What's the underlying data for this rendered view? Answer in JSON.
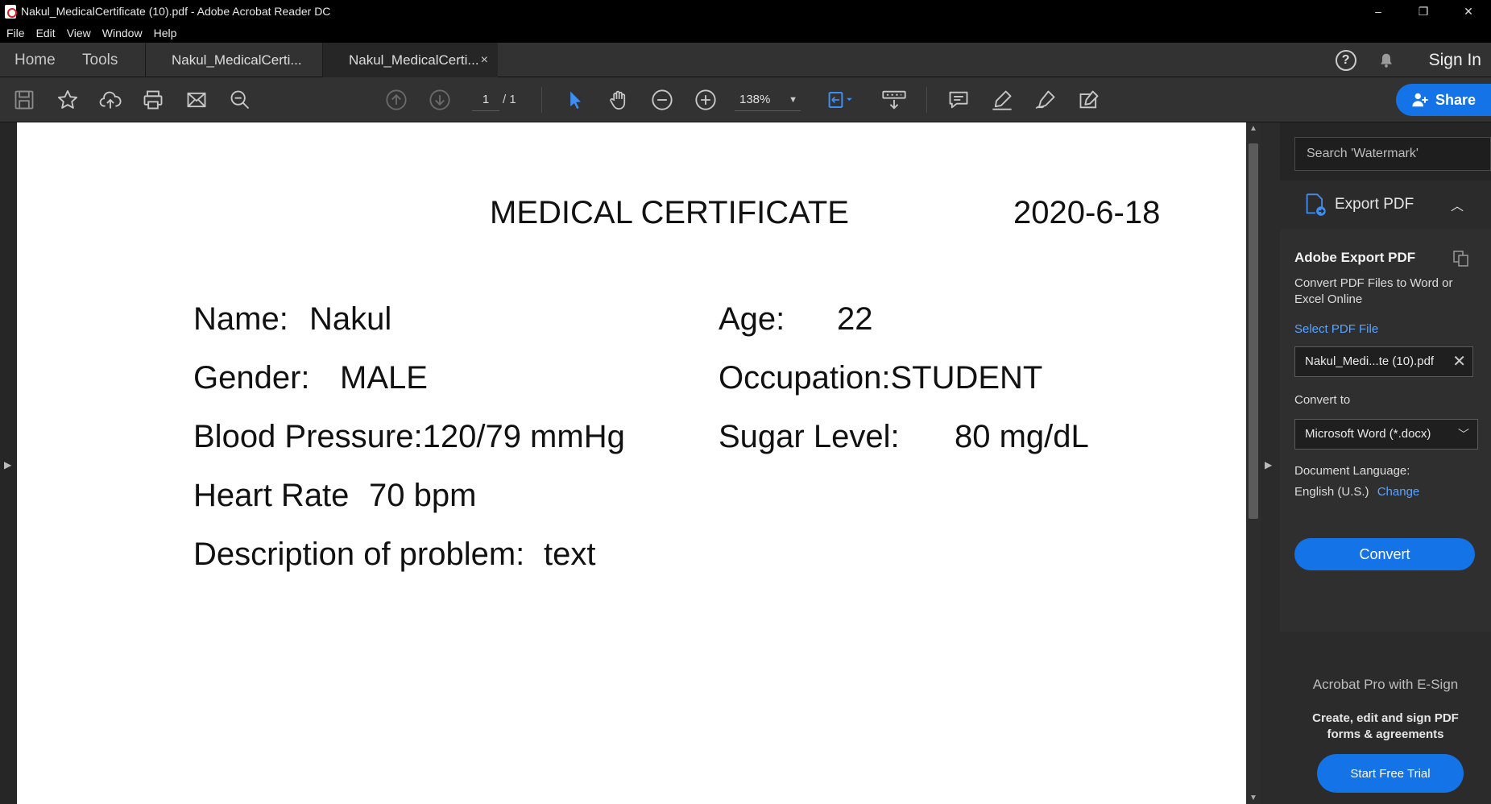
{
  "window": {
    "title": "Nakul_MedicalCertificate (10).pdf - Adobe Acrobat Reader DC",
    "controls": [
      "–",
      "❐",
      "✕"
    ]
  },
  "menu": [
    "File",
    "Edit",
    "View",
    "Window",
    "Help"
  ],
  "tabs": {
    "home": "Home",
    "tools": "Tools",
    "doc1": "Nakul_MedicalCerti...",
    "doc2": "Nakul_MedicalCerti...",
    "close": "×"
  },
  "header_right": {
    "help": "?",
    "signin": "Sign In"
  },
  "toolbar": {
    "page_current": "1",
    "page_total": "/ 1",
    "zoom": "138%",
    "share_label": "Share",
    "accent": "#1473e6"
  },
  "document": {
    "title": "MEDICAL CERTIFICATE",
    "date": "2020-6-18",
    "name_label": "Name:",
    "name_value": "Nakul",
    "age_label": "Age:",
    "age_value": "22",
    "gender_label": "Gender:",
    "gender_value": "MALE",
    "occupation": "Occupation:STUDENT",
    "bp": "Blood Pressure:120/79 mmHg",
    "sugar_label": "Sugar Level:",
    "sugar_value": "80 mg/dL",
    "heart_label": "Heart Rate",
    "heart_value": "70 bpm",
    "desc_label": "Description of problem:",
    "desc_value": "text"
  },
  "panel": {
    "search_placeholder": "Search 'Watermark'",
    "export_header": "Export PDF",
    "export_title": "Adobe Export PDF",
    "export_desc": "Convert PDF Files to Word or Excel Online",
    "select_label": "Select PDF File",
    "file_name": "Nakul_Medi...te (10).pdf",
    "convert_to_label": "Convert to",
    "format": "Microsoft Word (*.docx)",
    "lang_label": "Document Language:",
    "lang_value": "English (U.S.)",
    "lang_change": "Change",
    "convert_button": "Convert",
    "promo_title": "Acrobat Pro with E-Sign",
    "promo_desc": "Create, edit and sign PDF forms & agreements",
    "trial_button": "Start Free Trial"
  }
}
